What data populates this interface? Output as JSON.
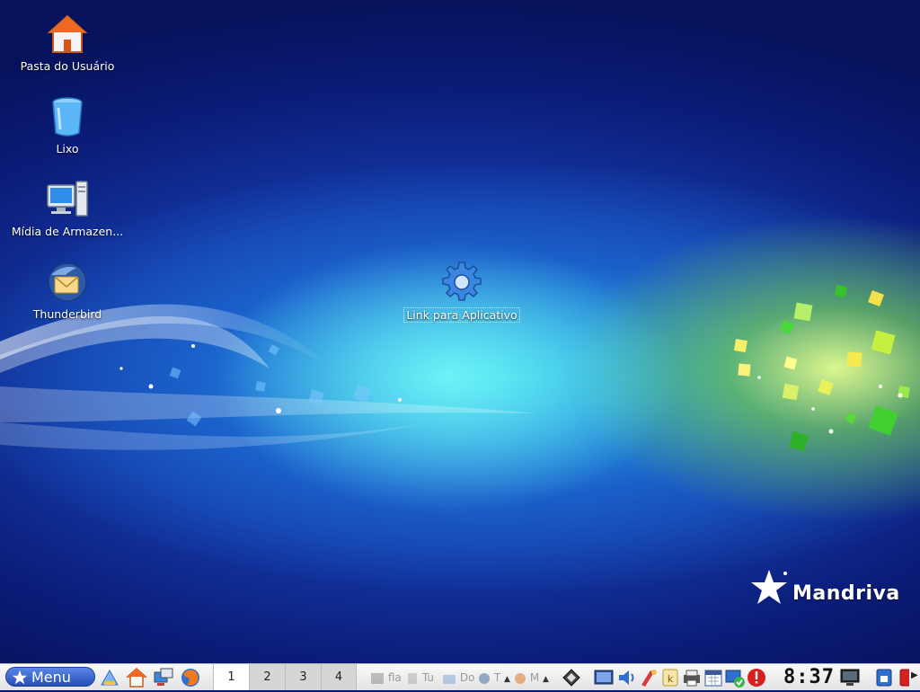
{
  "desktop": {
    "icons": [
      {
        "label": "Pasta do Usuário",
        "icon": "home-folder-icon"
      },
      {
        "label": "Lixo",
        "icon": "trash-icon"
      },
      {
        "label": "Mídia de Armazen...",
        "icon": "computer-icon"
      },
      {
        "label": "Thunderbird",
        "icon": "thunderbird-icon"
      },
      {
        "label": "Link para Aplicativo",
        "icon": "gear-icon"
      }
    ],
    "brand": "Mandriva"
  },
  "taskbar": {
    "menu_label": "Menu",
    "quicklaunch": [
      "kde-desktop-icon",
      "home-icon",
      "network-icon",
      "firefox-icon"
    ],
    "virtual_desktops": [
      "1",
      "2",
      "3",
      "4"
    ],
    "active_desktop": "1",
    "tasks": [
      {
        "label": "fla",
        "icon": "terminal-icon"
      },
      {
        "label": "Tu",
        "icon": "document-icon"
      },
      {
        "label": "Do",
        "icon": "folder-icon"
      },
      {
        "label": "T",
        "icon": "thunderbird-icon"
      },
      {
        "label": "M",
        "icon": "firefox-icon"
      }
    ],
    "tray": [
      "clipboard-icon",
      "display-icon",
      "volume-icon",
      "paint-icon",
      "keyboard-icon",
      "printer-icon",
      "calendar-icon",
      "network-status-icon",
      "alert-icon"
    ],
    "clock": "8:37",
    "colors": {
      "accent": "#2450b8",
      "alert": "#d62020"
    }
  }
}
